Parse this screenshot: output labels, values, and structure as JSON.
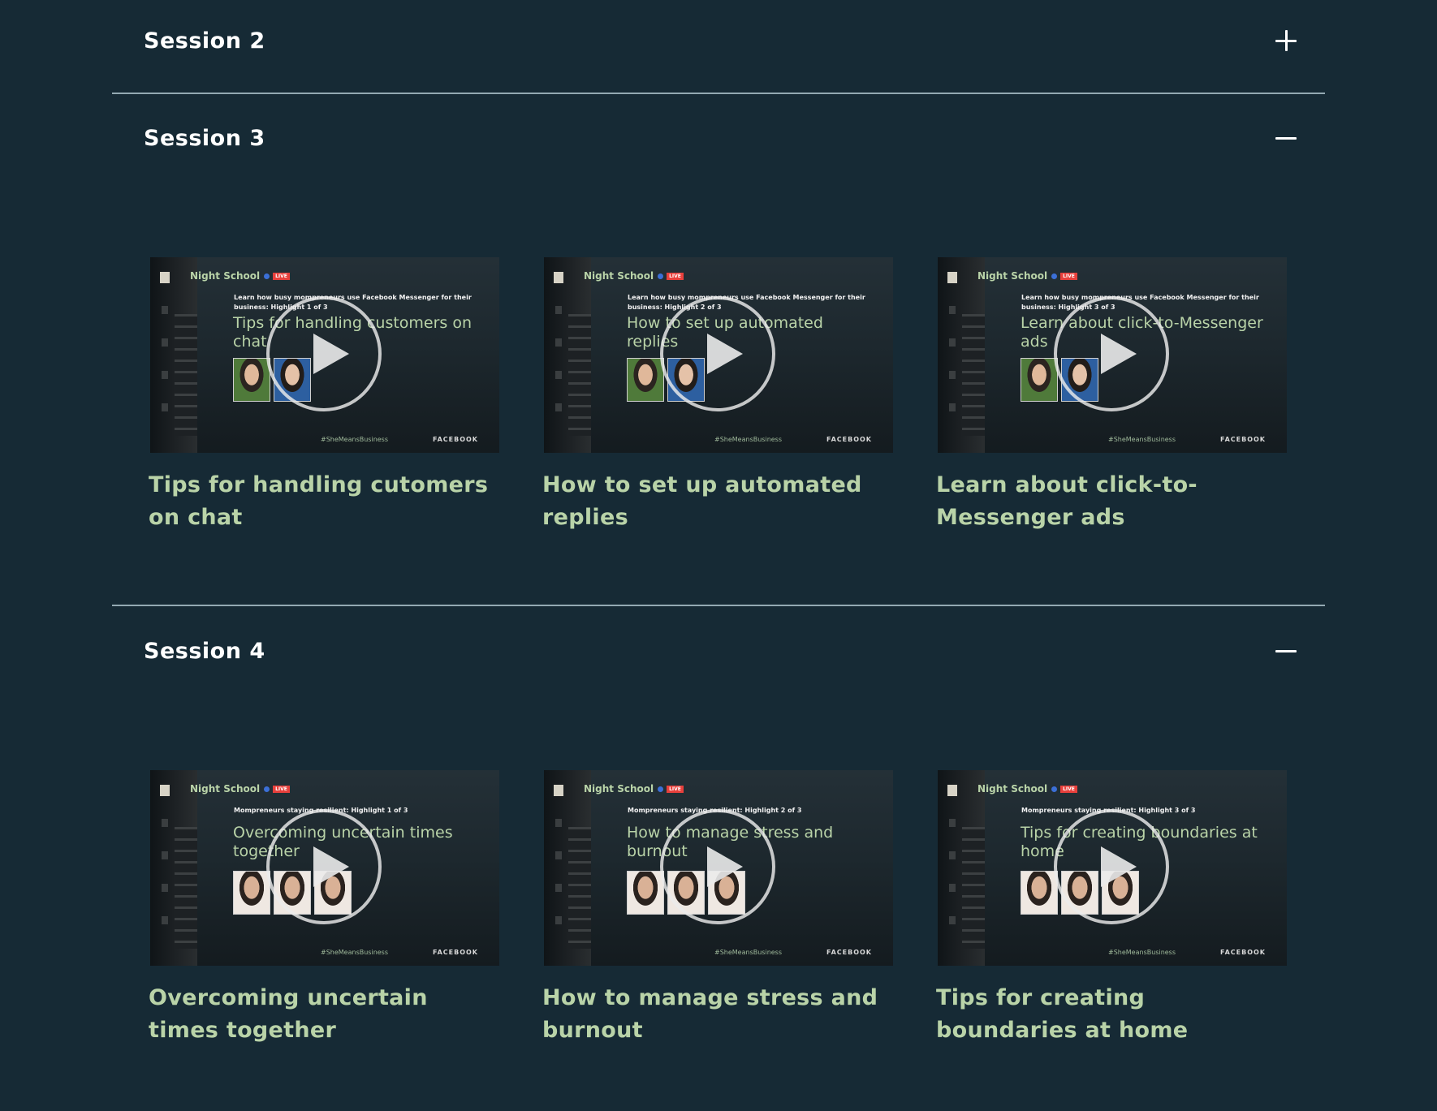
{
  "sessions": [
    {
      "title": "Session 2",
      "toggle_icon": "plus-icon",
      "expanded": false,
      "videos": []
    },
    {
      "title": "Session 3",
      "toggle_icon": "minus-icon",
      "expanded": true,
      "videos": [
        {
          "brand": "Night School",
          "live_badge": "LIVE",
          "subhead": "Learn how busy mompreneurs use Facebook Messenger for their business: Highlight 1 of 3",
          "thumb_title": "Tips for handling customers on chat",
          "hashtag": "#SheMeansBusiness",
          "wordmark": "FACEBOOK",
          "caption": "Tips for handling cutomers on chat"
        },
        {
          "brand": "Night School",
          "live_badge": "LIVE",
          "subhead": "Learn how busy mompreneurs use Facebook Messenger for their business: Highlight 2 of 3",
          "thumb_title": "How to set up automated replies",
          "hashtag": "#SheMeansBusiness",
          "wordmark": "FACEBOOK",
          "caption": "How to set up automated replies"
        },
        {
          "brand": "Night School",
          "live_badge": "LIVE",
          "subhead": "Learn how busy mompreneurs use Facebook Messenger for their business: Highlight 3 of 3",
          "thumb_title": "Learn about click-to-Messenger ads",
          "hashtag": "#SheMeansBusiness",
          "wordmark": "FACEBOOK",
          "caption": "Learn about click-to-Messenger ads"
        }
      ]
    },
    {
      "title": "Session 4",
      "toggle_icon": "minus-icon",
      "expanded": true,
      "videos": [
        {
          "brand": "Night School",
          "live_badge": "LIVE",
          "subhead": "Mompreneurs staying resilient: Highlight 1 of 3",
          "thumb_title": "Overcoming uncertain times together",
          "hashtag": "#SheMeansBusiness",
          "wordmark": "FACEBOOK",
          "caption": "Overcoming uncertain times together"
        },
        {
          "brand": "Night School",
          "live_badge": "LIVE",
          "subhead": "Mompreneurs staying resilient: Highlight 2 of 3",
          "thumb_title": "How to manage stress and burnout",
          "hashtag": "#SheMeansBusiness",
          "wordmark": "FACEBOOK",
          "caption": "How to manage stress and burnout"
        },
        {
          "brand": "Night School",
          "live_badge": "LIVE",
          "subhead": "Mompreneurs staying resilient: Highlight 3 of 3",
          "thumb_title": "Tips for creating boundaries at home",
          "hashtag": "#SheMeansBusiness",
          "wordmark": "FACEBOOK",
          "caption": "Tips for creating boundaries at home"
        }
      ]
    }
  ],
  "colors": {
    "background": "#162a35",
    "accent_text": "#b9d3a8",
    "heading_text": "#ffffff",
    "divider": "#a9c0c8"
  }
}
